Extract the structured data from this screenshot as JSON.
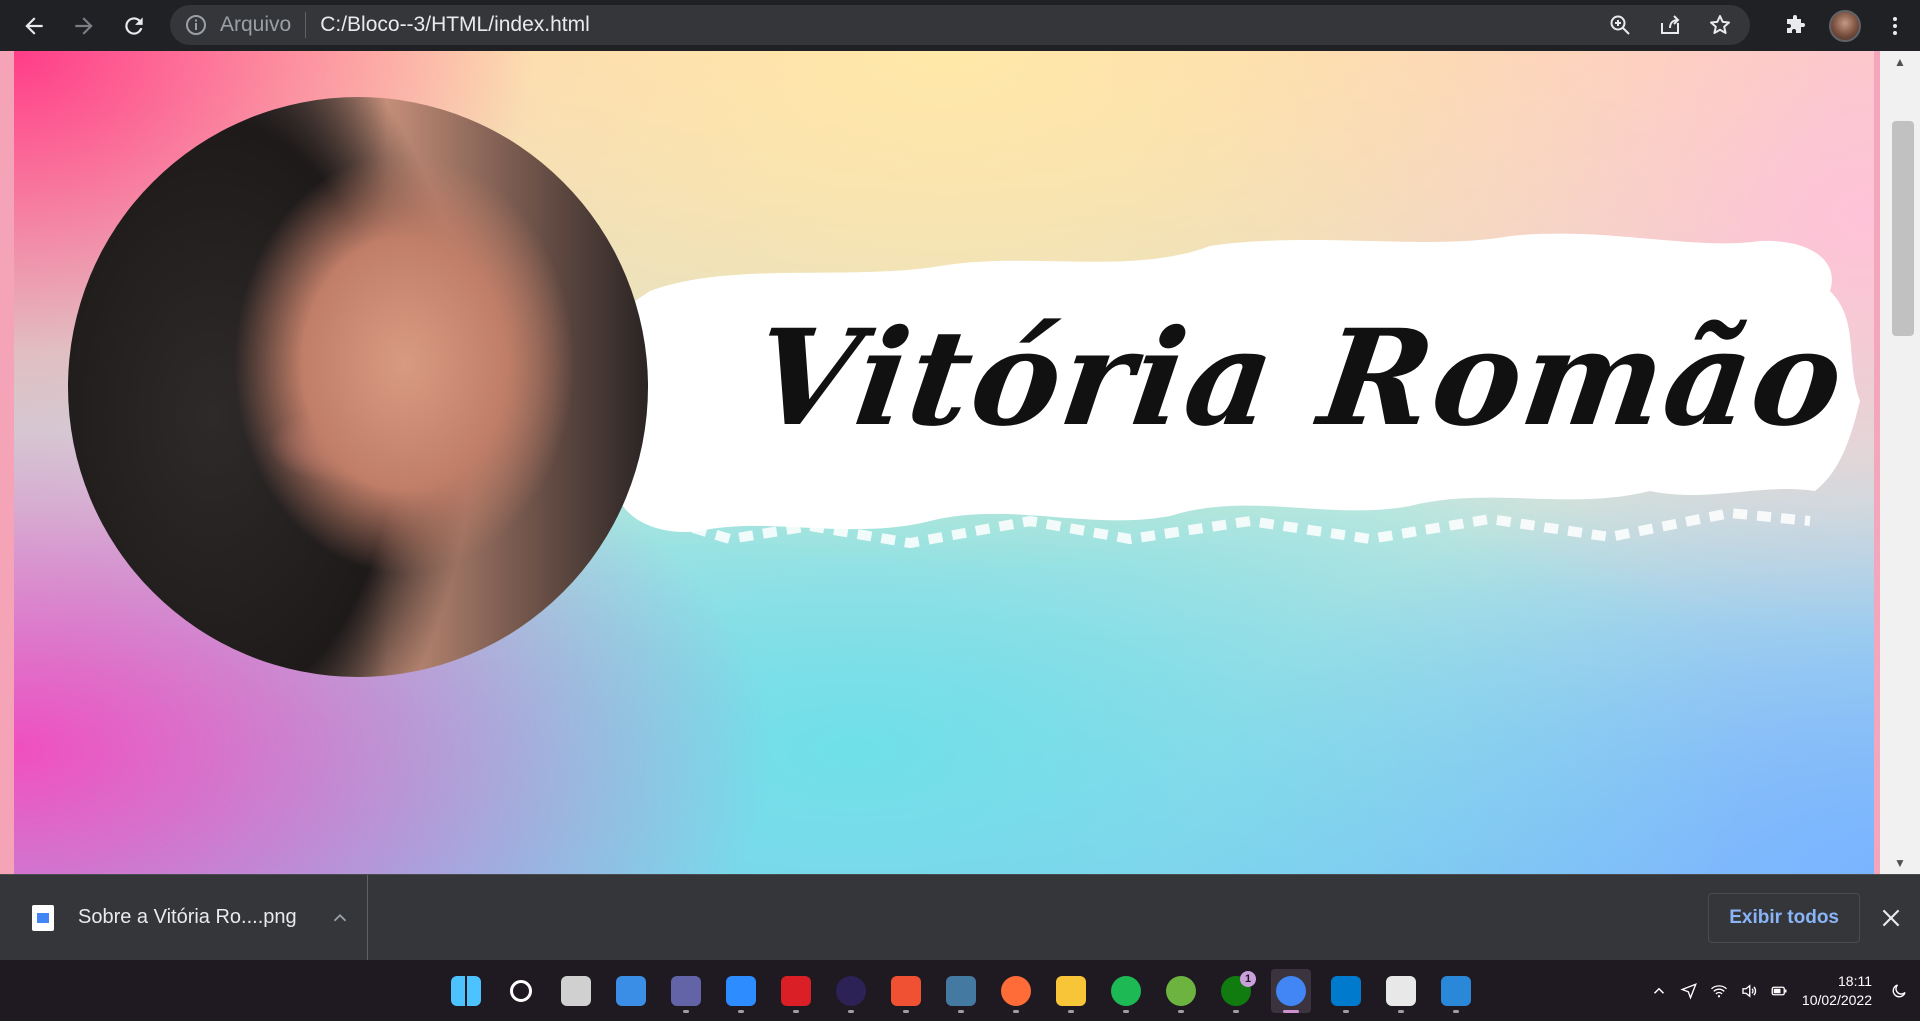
{
  "browser": {
    "scheme_label": "Arquivo",
    "url": "C:/Bloco--3/HTML/index.html"
  },
  "page": {
    "heading": "Vitória Romão"
  },
  "download_shelf": {
    "item_name": "Sobre a Vitória Ro....png",
    "show_all_label": "Exibir todos"
  },
  "taskbar": {
    "apps": [
      {
        "name": "start-button",
        "color": "#4cc2ff"
      },
      {
        "name": "search-button",
        "color": "#ffffff"
      },
      {
        "name": "task-view-button",
        "color": "#d0d0d0"
      },
      {
        "name": "widgets-button",
        "color": "#3a8ee6"
      },
      {
        "name": "teams-button",
        "color": "#6264a7"
      },
      {
        "name": "zoom-button",
        "color": "#2d8cff"
      },
      {
        "name": "creative-cloud-button",
        "color": "#da1f26"
      },
      {
        "name": "eclipse-button",
        "color": "#2c2255"
      },
      {
        "name": "git-button",
        "color": "#f05133"
      },
      {
        "name": "mysql-workbench-button",
        "color": "#4479a1"
      },
      {
        "name": "postman-button",
        "color": "#ff6c37"
      },
      {
        "name": "file-explorer-button",
        "color": "#f8c438"
      },
      {
        "name": "spotify-button",
        "color": "#1db954"
      },
      {
        "name": "spring-button",
        "color": "#6db33f"
      },
      {
        "name": "xbox-button",
        "color": "#107c10"
      },
      {
        "name": "chrome-button",
        "color": "#4285f4"
      },
      {
        "name": "vscode-button",
        "color": "#007acc"
      },
      {
        "name": "snipping-tool-button",
        "color": "#e8e8e8"
      },
      {
        "name": "photos-button",
        "color": "#2b88d8"
      }
    ],
    "xbox_badge": "1",
    "time": "18:11",
    "date": "10/02/2022"
  }
}
